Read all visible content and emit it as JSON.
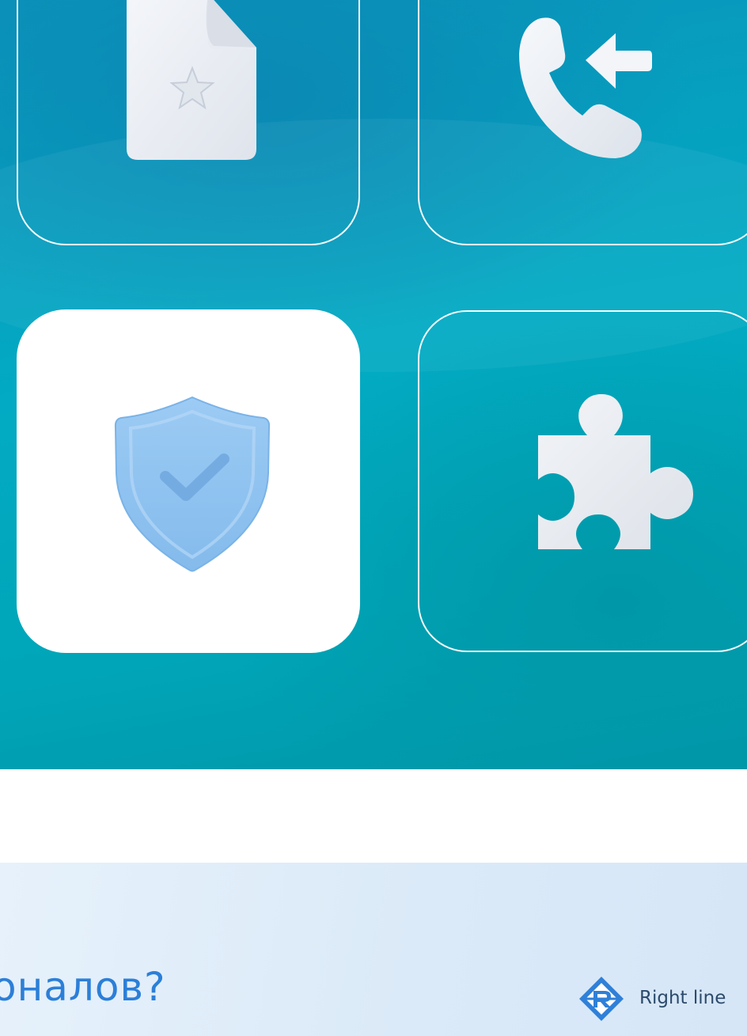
{
  "hero": {
    "cards": [
      {
        "id": "document",
        "icon": "document-star-icon",
        "style": "outline"
      },
      {
        "id": "incoming-call",
        "icon": "incoming-call-icon",
        "style": "outline"
      },
      {
        "id": "security",
        "icon": "shield-check-icon",
        "style": "filled"
      },
      {
        "id": "integration",
        "icon": "puzzle-piece-icon",
        "style": "outline"
      }
    ]
  },
  "footer": {
    "headline": "оналов?",
    "brand_name": "Right line",
    "brand_logo": "right-line-logo-icon"
  },
  "colors": {
    "accent": "#2b7fd8",
    "hero_teal": "#00a6b8",
    "shield_blue": "#8fc4f1",
    "band_bg": "#dceaf8"
  }
}
